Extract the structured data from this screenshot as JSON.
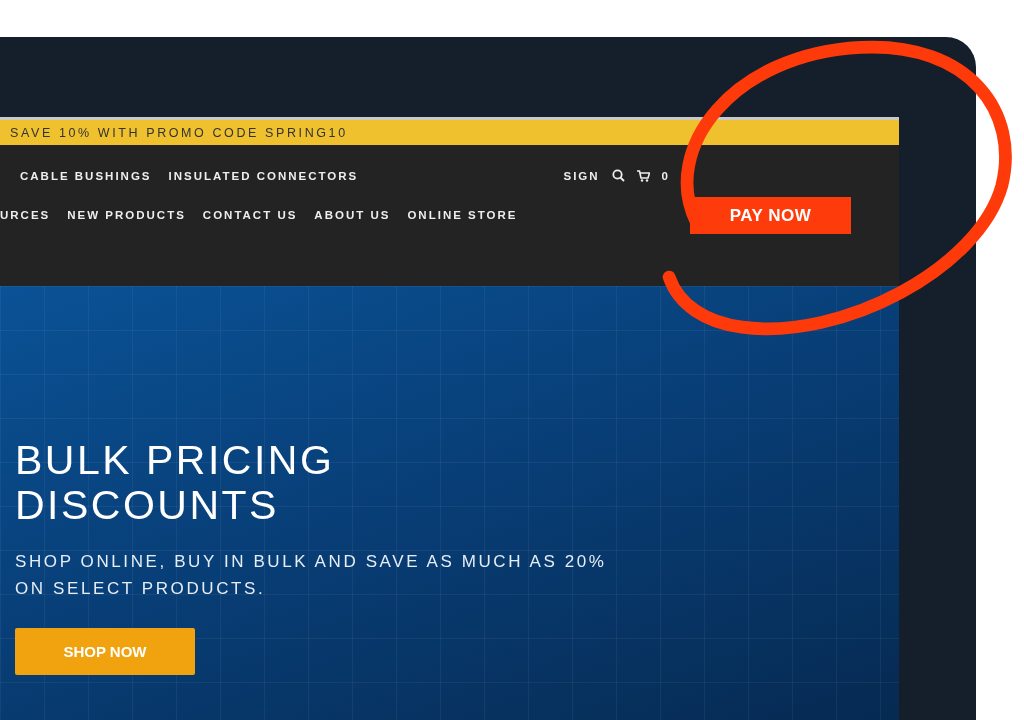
{
  "promo_bar": {
    "text": "SAVE 10% WITH PROMO CODE SPRING10"
  },
  "nav": {
    "primary_links": [
      {
        "label": "CABLE BUSHINGS"
      },
      {
        "label": "INSULATED CONNECTORS"
      }
    ],
    "secondary_links": [
      {
        "label": "URCES"
      },
      {
        "label": "NEW PRODUCTS"
      },
      {
        "label": "CONTACT US"
      },
      {
        "label": "ABOUT US"
      },
      {
        "label": "ONLINE STORE"
      }
    ],
    "sign_in": "SIGN",
    "cart_count": "0",
    "pay_button": "PAY NOW"
  },
  "hero": {
    "title": "BULK PRICING DISCOUNTS",
    "subtitle": "SHOP ONLINE, BUY IN BULK AND SAVE AS MUCH AS 20% ON SELECT PRODUCTS.",
    "button": "SHOP NOW"
  }
}
